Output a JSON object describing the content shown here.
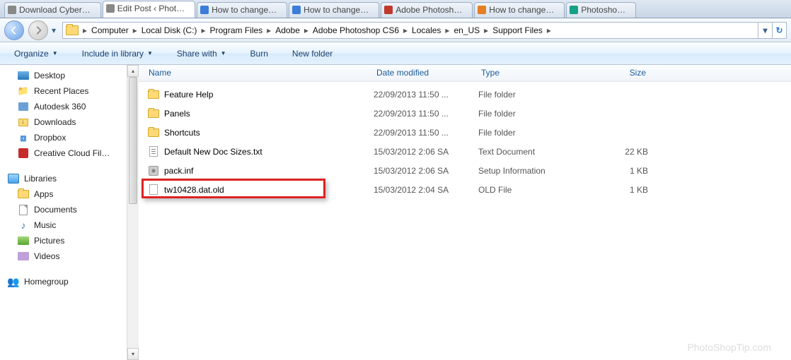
{
  "tabs": [
    {
      "label": "Download Cyber…"
    },
    {
      "label": "Edit Post ‹ Phot…"
    },
    {
      "label": "How to change…"
    },
    {
      "label": "How to change…"
    },
    {
      "label": "Adobe Photosh…"
    },
    {
      "label": "How to change…"
    },
    {
      "label": "Photosho…"
    }
  ],
  "breadcrumb": [
    "Computer",
    "Local Disk (C:)",
    "Program Files",
    "Adobe",
    "Adobe Photoshop CS6",
    "Locales",
    "en_US",
    "Support Files"
  ],
  "cmd": {
    "organize": "Organize",
    "include": "Include in library",
    "share": "Share with",
    "burn": "Burn",
    "newfolder": "New folder"
  },
  "nav": {
    "top": [
      {
        "icon": "desk",
        "label": "Desktop"
      },
      {
        "icon": "recent",
        "label": "Recent Places"
      },
      {
        "icon": "auto",
        "label": "Autodesk 360"
      },
      {
        "icon": "dl",
        "label": "Downloads"
      },
      {
        "icon": "drop",
        "label": "Dropbox"
      },
      {
        "icon": "cc",
        "label": "Creative Cloud Fil…"
      }
    ],
    "libraries_label": "Libraries",
    "libraries": [
      {
        "icon": "folder",
        "label": "Apps"
      },
      {
        "icon": "doc",
        "label": "Documents"
      },
      {
        "icon": "mus",
        "label": "Music"
      },
      {
        "icon": "pic",
        "label": "Pictures"
      },
      {
        "icon": "vid",
        "label": "Videos"
      }
    ],
    "homegroup_label": "Homegroup"
  },
  "cols": {
    "name": "Name",
    "date": "Date modified",
    "type": "Type",
    "size": "Size"
  },
  "files": [
    {
      "icon": "folder",
      "name": "Feature Help",
      "date": "22/09/2013 11:50 ...",
      "type": "File folder",
      "size": ""
    },
    {
      "icon": "folder",
      "name": "Panels",
      "date": "22/09/2013 11:50 ...",
      "type": "File folder",
      "size": ""
    },
    {
      "icon": "folder",
      "name": "Shortcuts",
      "date": "22/09/2013 11:50 ...",
      "type": "File folder",
      "size": ""
    },
    {
      "icon": "txt",
      "name": "Default New Doc Sizes.txt",
      "date": "15/03/2012 2:06 SA",
      "type": "Text Document",
      "size": "22 KB"
    },
    {
      "icon": "setup",
      "name": "pack.inf",
      "date": "15/03/2012 2:06 SA",
      "type": "Setup Information",
      "size": "1 KB"
    },
    {
      "icon": "blank",
      "name": "tw10428.dat.old",
      "date": "15/03/2012 2:04 SA",
      "type": "OLD File",
      "size": "1 KB"
    }
  ],
  "watermark": "PhotoShopTip.com"
}
